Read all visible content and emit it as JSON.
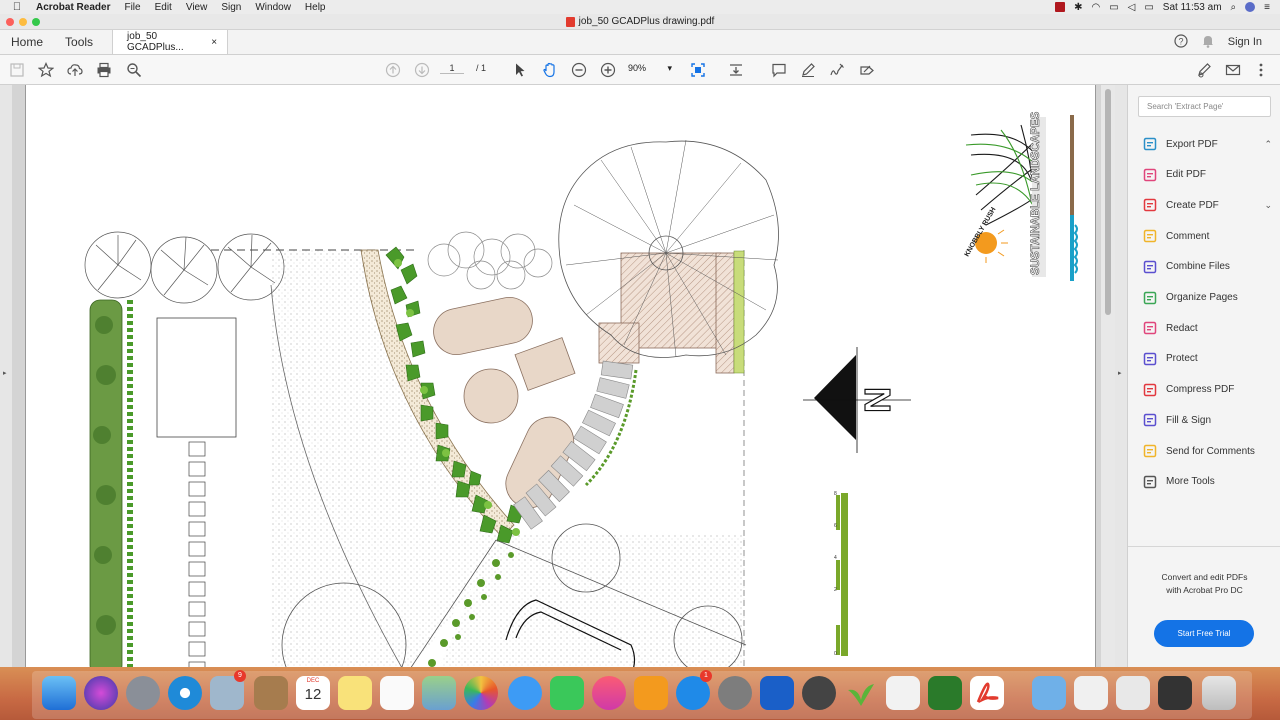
{
  "menubar": {
    "app_name": "Acrobat Reader",
    "items": [
      "File",
      "Edit",
      "View",
      "Sign",
      "Window",
      "Help"
    ],
    "clock": "Sat 11:53 am"
  },
  "window": {
    "title": "job_50 GCADPlus drawing.pdf"
  },
  "tabs": {
    "home": "Home",
    "tools": "Tools",
    "doc": "job_50 GCADPlus...",
    "close": "×",
    "sign_in": "Sign In"
  },
  "toolbar": {
    "page_current": "1",
    "page_sep": "/",
    "page_total": "1",
    "zoom": "90%"
  },
  "drawing": {
    "logo_brand": "SUSTAINABLE LANDSCAPES",
    "logo_sub": "KNOBBLY RUSH",
    "north_label": "N",
    "scale_ticks": [
      "8",
      "6",
      "4",
      "2",
      "0"
    ]
  },
  "right_pane": {
    "search_placeholder": "Search 'Extract Page'",
    "tools": [
      {
        "label": "Export PDF",
        "icon": "export-pdf-icon",
        "color": "#2a8fc8",
        "chevron": "⌃"
      },
      {
        "label": "Edit PDF",
        "icon": "edit-pdf-icon",
        "color": "#e0457b",
        "chevron": ""
      },
      {
        "label": "Create PDF",
        "icon": "create-pdf-icon",
        "color": "#e2383f",
        "chevron": "⌄"
      },
      {
        "label": "Comment",
        "icon": "comment-icon",
        "color": "#f0b429",
        "chevron": ""
      },
      {
        "label": "Combine Files",
        "icon": "combine-files-icon",
        "color": "#5a4fcf",
        "chevron": ""
      },
      {
        "label": "Organize Pages",
        "icon": "organize-pages-icon",
        "color": "#3aa655",
        "chevron": ""
      },
      {
        "label": "Redact",
        "icon": "redact-icon",
        "color": "#e0457b",
        "chevron": ""
      },
      {
        "label": "Protect",
        "icon": "protect-icon",
        "color": "#5a4fcf",
        "chevron": ""
      },
      {
        "label": "Compress PDF",
        "icon": "compress-pdf-icon",
        "color": "#e2383f",
        "chevron": ""
      },
      {
        "label": "Fill & Sign",
        "icon": "fill-sign-icon",
        "color": "#5a4fcf",
        "chevron": ""
      },
      {
        "label": "Send for Comments",
        "icon": "send-for-comments-icon",
        "color": "#f0b429",
        "chevron": ""
      },
      {
        "label": "More Tools",
        "icon": "more-tools-icon",
        "color": "#555555",
        "chevron": ""
      }
    ],
    "promo_line1": "Convert and edit PDFs",
    "promo_line2": "with Acrobat Pro DC",
    "trial_button": "Start Free Trial"
  },
  "dock": {
    "calendar_month": "DEC",
    "calendar_day": "12",
    "badge_photos": "9",
    "badge_appstore": "1"
  },
  "colors": {
    "accent": "#1473e6",
    "pdf_red": "#e23b2e"
  }
}
